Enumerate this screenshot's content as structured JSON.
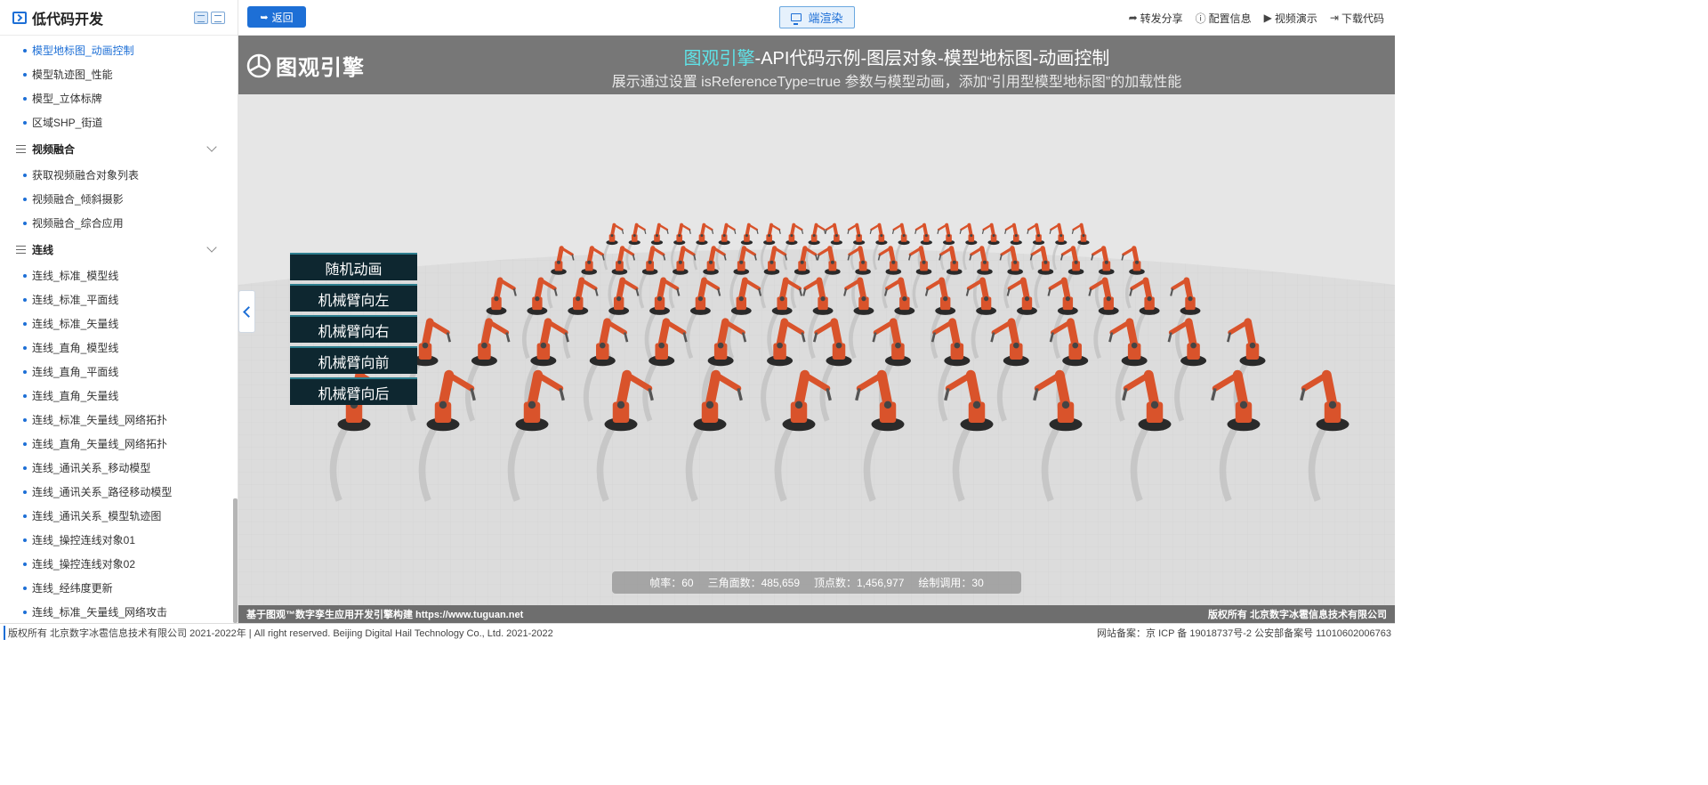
{
  "sidebar": {
    "title": "低代码开发",
    "items": [
      {
        "kind": "item",
        "label": "模型地标图_动画控制",
        "active": true
      },
      {
        "kind": "item",
        "label": "模型轨迹图_性能"
      },
      {
        "kind": "item",
        "label": "模型_立体标牌"
      },
      {
        "kind": "item",
        "label": "区域SHP_街道"
      },
      {
        "kind": "group",
        "label": "视频融合"
      },
      {
        "kind": "item",
        "label": "获取视频融合对象列表"
      },
      {
        "kind": "item",
        "label": "视频融合_倾斜摄影"
      },
      {
        "kind": "item",
        "label": "视频融合_综合应用"
      },
      {
        "kind": "group",
        "label": "连线"
      },
      {
        "kind": "item",
        "label": "连线_标准_模型线"
      },
      {
        "kind": "item",
        "label": "连线_标准_平面线"
      },
      {
        "kind": "item",
        "label": "连线_标准_矢量线"
      },
      {
        "kind": "item",
        "label": "连线_直角_模型线"
      },
      {
        "kind": "item",
        "label": "连线_直角_平面线"
      },
      {
        "kind": "item",
        "label": "连线_直角_矢量线"
      },
      {
        "kind": "item",
        "label": "连线_标准_矢量线_网络拓扑"
      },
      {
        "kind": "item",
        "label": "连线_直角_矢量线_网络拓扑"
      },
      {
        "kind": "item",
        "label": "连线_通讯关系_移动模型"
      },
      {
        "kind": "item",
        "label": "连线_通讯关系_路径移动模型"
      },
      {
        "kind": "item",
        "label": "连线_通讯关系_模型轨迹图"
      },
      {
        "kind": "item",
        "label": "连线_操控连线对象01"
      },
      {
        "kind": "item",
        "label": "连线_操控连线对象02"
      },
      {
        "kind": "item",
        "label": "连线_经纬度更新"
      },
      {
        "kind": "item",
        "label": "连线_标准_矢量线_网络攻击"
      }
    ]
  },
  "toolbar": {
    "back_label": "返回",
    "render_label": "端渲染",
    "actions": [
      {
        "icon": "share-icon",
        "label": "转发分享"
      },
      {
        "icon": "info-icon",
        "label": "配置信息"
      },
      {
        "icon": "play-icon",
        "label": "视频演示"
      },
      {
        "icon": "download-icon",
        "label": "下载代码"
      }
    ]
  },
  "banner": {
    "brand": "图观引擎",
    "title_highlight": "图观引擎",
    "title_rest": "-API代码示例-图层对象-模型地标图-动画控制",
    "subtitle": "展示通过设置 isReferenceType=true 参数与模型动画，添加“引用型模型地标图”的加载性能"
  },
  "animation_buttons": [
    "随机动画",
    "机械臂向左",
    "机械臂向右",
    "机械臂向前",
    "机械臂向后"
  ],
  "stats": {
    "fps": "帧率：60",
    "triangles": "三角面数：485,659",
    "vertices": "顶点数：1,456,977",
    "draw_calls": "绘制调用：30"
  },
  "viewport_footer": {
    "left": "基于图观™数字孪生应用开发引擎构建 https://www.tuguan.net",
    "right": "版权所有 北京数字冰雹信息技术有限公司"
  },
  "page_footer": {
    "left": "版权所有 北京数字冰雹信息技术有限公司 2021-2022年 | All right reserved. Beijing Digital Hail Technology Co., Ltd. 2021-2022",
    "right": "网站备案：京 ICP 备 19018737号-2 公安部备案号 11010602006763"
  },
  "colors": {
    "accent": "#1d6fd6",
    "highlight": "#5fe3e8",
    "robot": "#d9532b",
    "anim_button_bg": "#0e2730"
  }
}
